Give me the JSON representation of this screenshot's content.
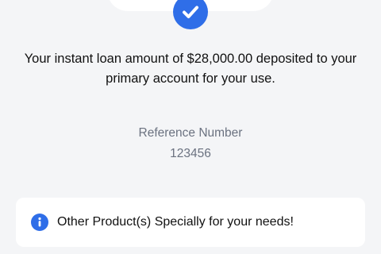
{
  "confirmation": {
    "icon": "check-icon",
    "message": "Your instant loan amount of $28,000.00 deposited to your primary account for your use."
  },
  "reference": {
    "label": "Reference Number",
    "number": "123456"
  },
  "promo": {
    "icon": "info-icon",
    "text": "Other Product(s) Specially for your needs!"
  },
  "colors": {
    "accent": "#2f6ee8",
    "background": "#f4f5f7",
    "card": "#ffffff",
    "muted_text": "#6b7280"
  }
}
